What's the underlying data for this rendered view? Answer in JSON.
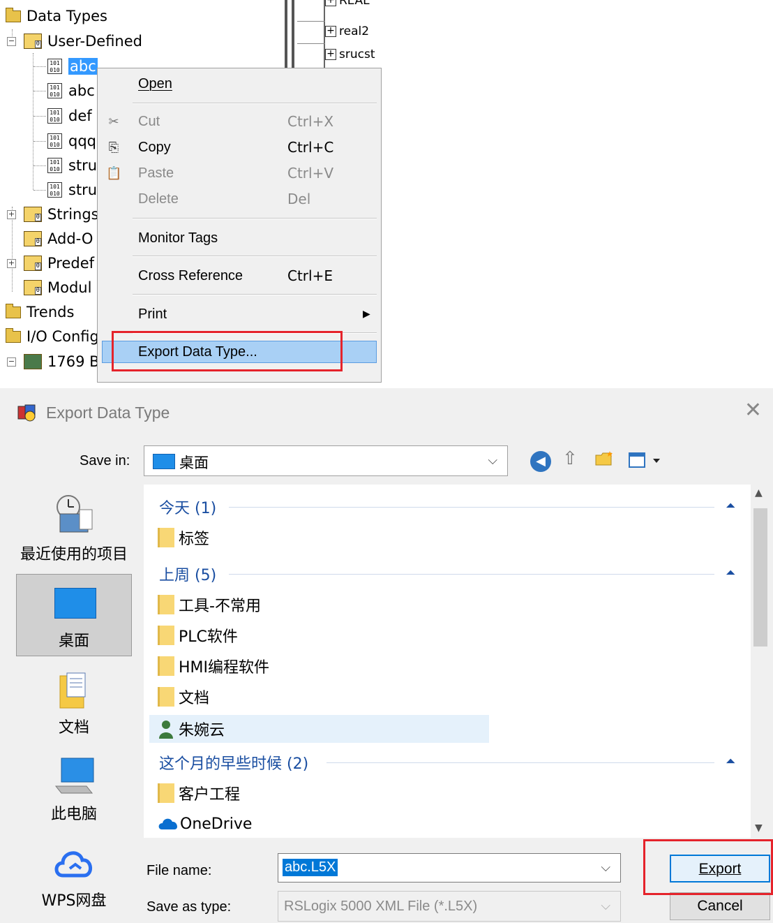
{
  "tree": {
    "data_types": "Data Types",
    "user_defined": "User-Defined",
    "items": [
      "abc",
      "abc",
      "def",
      "qqq",
      "stru",
      "stru"
    ],
    "strings": "Strings",
    "addon": "Add-O",
    "predefined": "Predef",
    "module": "Modul",
    "trends": "Trends",
    "io_config": "I/O Config",
    "device": "1769 B"
  },
  "strip": {
    "rows": [
      "REAL",
      "real2",
      "srucst"
    ]
  },
  "context_menu": {
    "open": "Open",
    "cut": "Cut",
    "cut_sc": "Ctrl+X",
    "copy": "Copy",
    "copy_sc": "Ctrl+C",
    "paste": "Paste",
    "paste_sc": "Ctrl+V",
    "delete": "Delete",
    "delete_sc": "Del",
    "monitor_tags": "Monitor Tags",
    "cross_reference": "Cross Reference",
    "cross_reference_sc": "Ctrl+E",
    "print": "Print",
    "export_data_type": "Export Data Type..."
  },
  "dialog": {
    "title": "Export Data Type",
    "save_in_label": "Save in:",
    "save_in_value": "桌面",
    "places": [
      "最近使用的项目",
      "桌面",
      "文档",
      "此电脑",
      "WPS网盘"
    ],
    "groups": [
      {
        "title": "今天 (1)",
        "items": [
          "标签"
        ]
      },
      {
        "title": "上周 (5)",
        "items": [
          "工具-不常用",
          "PLC软件",
          "HMI编程软件",
          "文档",
          "朱婉云"
        ]
      },
      {
        "title": "这个月的早些时候 (2)",
        "items": [
          "客户工程",
          "OneDrive"
        ]
      }
    ],
    "file_name_label": "File name:",
    "file_name_value": "abc.L5X",
    "save_as_type_label": "Save as type:",
    "save_as_type_value": "RSLogix 5000 XML File (*.L5X)",
    "export_button": "Export",
    "cancel_button": "Cancel"
  },
  "colors": {
    "highlight_red": "#e5232b",
    "selection_blue": "#3399ff",
    "link_blue": "#1a4ea1"
  }
}
